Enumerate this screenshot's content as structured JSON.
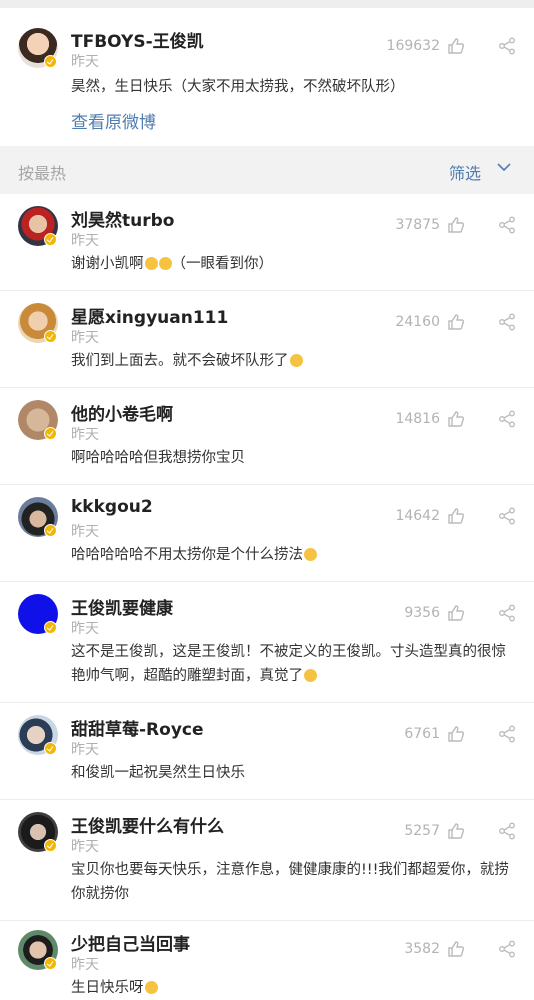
{
  "post": {
    "author": "TFBOYS-王俊凯",
    "time": "昨天",
    "likes": "169632",
    "text": "昊然，生日快乐（大家不用太捞我，不然破坏队形）",
    "view_original": "查看原微博"
  },
  "filter": {
    "sort_label": "按最热",
    "filter_label": "筛选"
  },
  "comments": [
    {
      "name": "刘昊然turbo",
      "time": "昨天",
      "likes": "37875",
      "text": "谢谢小凯啊",
      "text2": "（一眼看到你）"
    },
    {
      "name": "星愿xingyuan111",
      "time": "昨天",
      "likes": "24160",
      "text": "我们到上面去。就不会破坏队形了"
    },
    {
      "name": "他的小卷毛啊",
      "time": "昨天",
      "likes": "14816",
      "text": "啊哈哈哈哈但我想捞你宝贝"
    },
    {
      "name": "kkkgou2",
      "time": "昨天",
      "likes": "14642",
      "text": "哈哈哈哈哈不用太捞你是个什么捞法"
    },
    {
      "name": "王俊凯要健康",
      "time": "昨天",
      "likes": "9356",
      "text": "这不是王俊凯，这是王俊凯！不被定义的王俊凯。寸头造型真的很惊",
      "text2": "艳帅气啊，超酷的雕塑封面，真觉了"
    },
    {
      "name": "甜甜草莓-Royce",
      "time": "昨天",
      "likes": "6761",
      "text": "和俊凯一起祝昊然生日快乐"
    },
    {
      "name": "王俊凯要什么有什么",
      "time": "昨天",
      "likes": "5257",
      "text": "宝贝你也要每天快乐，注意作息，健健康康的!!!我们都超爱你，就捞",
      "text2": "你就捞你"
    },
    {
      "name": "少把自己当回事",
      "time": "昨天",
      "likes": "3582",
      "text": "生日快乐呀"
    }
  ],
  "colors": {
    "link": "#507daf",
    "badge": "#f2b705",
    "avatar_blue": "#1010e8"
  },
  "icons": [
    "thumb-up-icon",
    "share-icon",
    "chevron-down-icon",
    "verified-badge-icon"
  ]
}
